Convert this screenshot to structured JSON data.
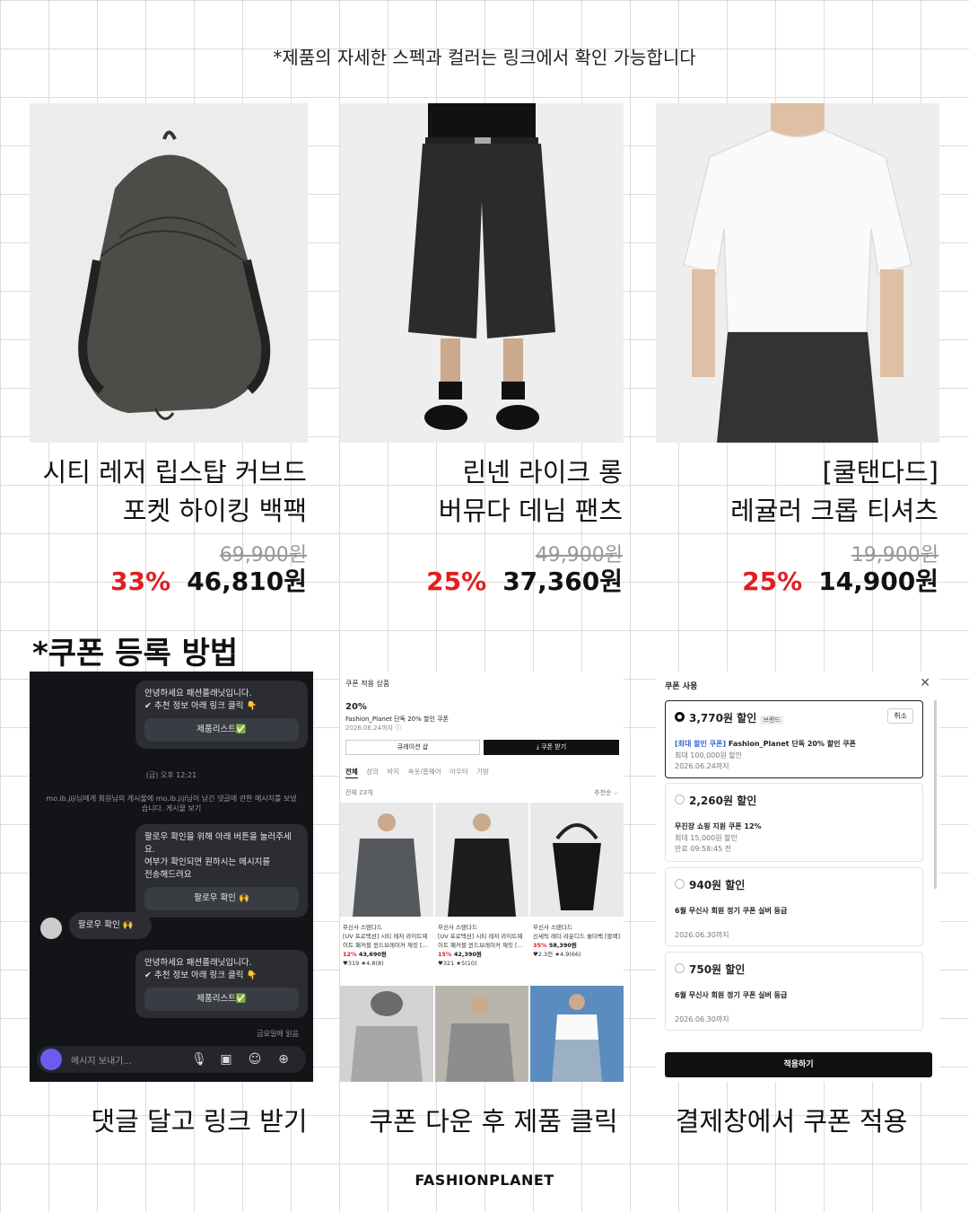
{
  "header": {
    "notice": "*제품의 자세한 스펙과 컬러는 링크에서 확인 가능합니다"
  },
  "products": [
    {
      "name_line1": "시티 레저 립스탑 커브드",
      "name_line2": "포켓 하이킹 백팩",
      "original_price": "69,900원",
      "discount": "33%",
      "price": "46,810원"
    },
    {
      "name_line1": "린넨 라이크 롱",
      "name_line2": "버뮤다 데님 팬츠",
      "original_price": "49,900원",
      "discount": "25%",
      "price": "37,360원"
    },
    {
      "name_line1": "[쿨탠다드]",
      "name_line2": "레귤러 크롭 티셔츠",
      "original_price": "19,900원",
      "discount": "25%",
      "price": "14,900원"
    }
  ],
  "coupon_section": {
    "title": "*쿠폰 등록 방법"
  },
  "chat": {
    "msg1": {
      "line1": "안녕하세요 패션플래닛입니다.",
      "line2": "✔ 추천 정보 아래 링크 클릭 👇",
      "button": "제품리스트✅"
    },
    "timestamp": "(금) 오후 12:21",
    "notice_line1": "mo.ib.jiji님에게 회원님의 게시물에 mo.ib.jiji님이 남긴 댓글에 관한 메시지를 보냈",
    "notice_line2": "습니다. 게시물 보기",
    "msg2": {
      "line1": "팔로우 확인을 위해 아래 버튼을 눌러주세요.",
      "line2": "여부가 확인되면 원하시는 메시지를",
      "line3": "전송해드려요",
      "button": "팔로우 확인 🙌"
    },
    "reply": "팔로우 확인 🙌",
    "msg3": {
      "line1": "안녕하세요 패션플래닛입니다.",
      "line2": "✔ 추천 정보 아래 링크 클릭 👇",
      "button": "제품리스트✅"
    },
    "read": "금요일에 읽음",
    "composer_placeholder": "메시지 보내기..."
  },
  "coupon_list": {
    "header": "쿠폰 적용 상품",
    "rate": "20%",
    "coupon_name": "Fashion_Planet 단독 20% 할인 쿠폰",
    "expiry": "2026.06.24까지 ⓘ",
    "btn_curation": "큐레이션 샵",
    "btn_download": "⤓ 쿠폰 받기",
    "tabs": [
      "전체",
      "상의",
      "바지",
      "속옷/홈웨어",
      "아우터",
      "가방"
    ],
    "count": "전체 23개",
    "sort": "추천순 ⌵",
    "items": [
      {
        "brand": "무신사 스탠다드",
        "title1": "[UV 프로텍션] 시티 레저 라이트웨",
        "title2": "이트 패커블 윈드브레이커 재킷 [...",
        "discount": "12%",
        "price": "43,690원",
        "stats": "♥319 ★4.8(8)"
      },
      {
        "brand": "무신사 스탠다드",
        "title1": "[UV 프로텍션] 시티 레저 라이트웨",
        "title2": "이트 패커블 윈드브레이커 재킷 [...",
        "discount": "15%",
        "price": "42,390원",
        "stats": "♥321 ★5(10)"
      },
      {
        "brand": "무신사 스탠다드",
        "title1": "신세틱 레더 라운디드 숄더백 [블랙]",
        "title2": "",
        "discount": "35%",
        "price": "58,390원",
        "stats": "♥2.3천 ★4.9(66)"
      }
    ]
  },
  "coupon_apply": {
    "title": "쿠폰 사용",
    "coupons": [
      {
        "amount": "3,770원 할인",
        "tag": "브랜드",
        "action": "취소",
        "line1_highlight": "[최대 할인 쿠폰]",
        "line1": " Fashion_Planet 단독 20% 할인 쿠폰",
        "line2": "최대 100,000원 할인",
        "line3": "2026.06.24까지"
      },
      {
        "amount": "2,260원 할인",
        "line1": "무진장 쇼핑 지원 쿠폰 12%",
        "line2": "최대 15,000원 할인",
        "line3": "만료 09:58:45 전"
      },
      {
        "amount": "940원 할인",
        "line1": "6월 무신사 회원 정기 쿠폰 실버 등급",
        "line3": "2026.06.30까지"
      },
      {
        "amount": "750원 할인",
        "line1": "6월 무신사 회원 정기 쿠폰 실버 등급",
        "line3": "2026.06.30까지"
      }
    ],
    "apply_button": "적용하기"
  },
  "captions": [
    "댓글 달고 링크 받기",
    "쿠폰 다운 후 제품 클릭",
    "결제창에서  쿠폰 적용"
  ],
  "brand": "FASHIONPLANET",
  "colors": {
    "discount_red": "#e31d1d",
    "chat_bg": "#121418",
    "grid_line": "#dcdcdc"
  }
}
